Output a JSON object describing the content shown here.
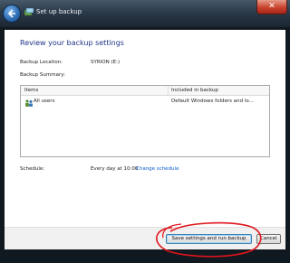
{
  "window": {
    "title": "Set up backup",
    "close_glyph": "✕"
  },
  "page": {
    "heading": "Review your backup settings"
  },
  "settings": {
    "location_label": "Backup Location:",
    "location_value": "SYRION (E:)",
    "summary_label": "Backup Summary:"
  },
  "table": {
    "columns": [
      "Items",
      "Included in backup"
    ],
    "rows": [
      {
        "item": "All users",
        "included": "Default Windows folders and lo..."
      }
    ]
  },
  "schedule": {
    "label": "Schedule:",
    "value": "Every day at 10:00",
    "change_link": "Change schedule"
  },
  "footer": {
    "save_label": "Save settings and run backup",
    "cancel_label": "Cancel"
  },
  "icons": [
    "back-arrow-icon",
    "backup-icon",
    "users-icon",
    "close-icon",
    "shield-icon"
  ],
  "colors": {
    "heading": "#1e3287",
    "link": "#0b5bd1",
    "annotation": "#e0141b"
  }
}
